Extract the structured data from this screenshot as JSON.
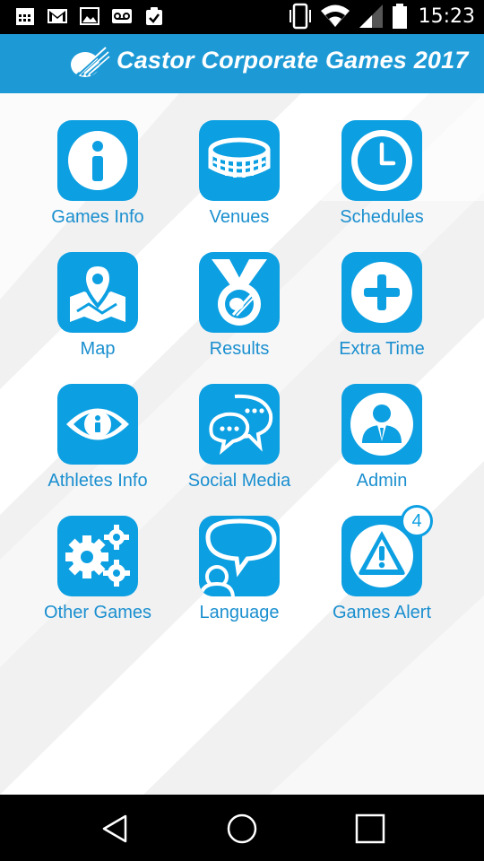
{
  "status_bar": {
    "time": "15:23",
    "icons": [
      "calendar-icon",
      "gmail-icon",
      "image-icon",
      "voicemail-icon",
      "clipboard-check-icon",
      "vibrate-icon",
      "wifi-icon",
      "signal-icon",
      "battery-icon"
    ]
  },
  "header": {
    "title": "Castor Corporate Games 2017",
    "brand_color": "#1d9ad6"
  },
  "tiles": [
    {
      "label": "Games Info",
      "icon": "info-icon"
    },
    {
      "label": "Venues",
      "icon": "stadium-icon"
    },
    {
      "label": "Schedules",
      "icon": "clock-icon"
    },
    {
      "label": "Map",
      "icon": "map-pin-icon"
    },
    {
      "label": "Results",
      "icon": "medal-icon"
    },
    {
      "label": "Extra Time",
      "icon": "plus-icon"
    },
    {
      "label": "Athletes Info",
      "icon": "eye-info-icon"
    },
    {
      "label": "Social Media",
      "icon": "chat-bubbles-icon"
    },
    {
      "label": "Admin",
      "icon": "admin-user-icon"
    },
    {
      "label": "Other Games",
      "icon": "gears-icon"
    },
    {
      "label": "Language",
      "icon": "speech-bubble-user-icon"
    },
    {
      "label": "Games Alert",
      "icon": "warning-icon",
      "badge": "4"
    }
  ],
  "nav": {
    "icons": [
      "back-triangle-icon",
      "home-circle-icon",
      "recents-square-icon"
    ]
  },
  "colors": {
    "tile": "#0c9fe2",
    "label": "#1a8fcf",
    "background": "#f1f1f2"
  }
}
